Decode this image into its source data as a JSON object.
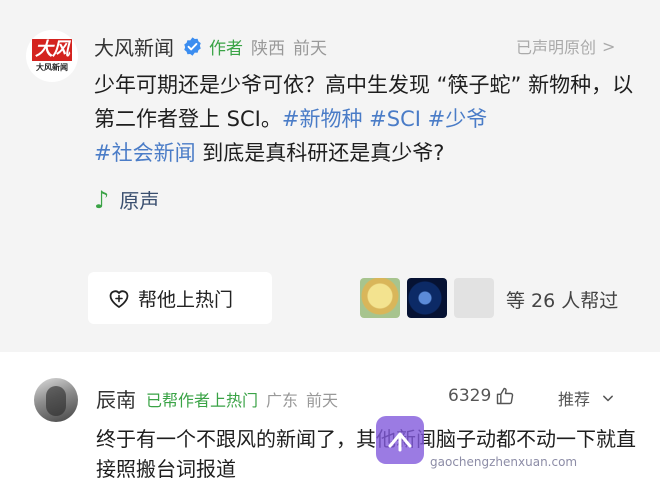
{
  "post": {
    "logo_text": "大风",
    "logo_sub": "大风新闻",
    "author": "大风新闻",
    "author_tag": "作者",
    "location": "陕西",
    "time": "前天",
    "original_label": "已声明原创",
    "content_plain_1": "少年可期还是少爷可依？高中生发现 “筷子蛇” 新物种，以第二作者登上 SCI。",
    "tags": [
      "#新物种",
      "#SCI",
      "#少爷",
      "#社会新闻"
    ],
    "content_plain_2": " 到底是真科研还是真少爷?",
    "sound_label": "原声",
    "hot_button_label": "帮他上热门",
    "helper_count_label": "等 26 人帮过"
  },
  "comment": {
    "user": "辰南",
    "badge": "已帮作者上热门",
    "location": "广东",
    "time": "前天",
    "likes": "6329",
    "recommend_label": "推荐",
    "text": "终于有一个不跟风的新闻了，其他新闻脑子动都不动一下就直接照搬台词报道"
  },
  "watermark": {
    "text": "gaochengzhenxuan.com"
  },
  "colors": {
    "green": "#3aa346",
    "tag_blue": "#4a7cc7",
    "logo_red": "#d4231f",
    "bg_gray": "#f4f4f4"
  },
  "icons": {
    "verified": "verified-badge-icon",
    "chevron": "chevron-right-icon",
    "note": "music-note-icon",
    "heart": "heart-plus-icon",
    "thumb": "thumbs-up-icon",
    "down": "chevron-down-icon"
  }
}
